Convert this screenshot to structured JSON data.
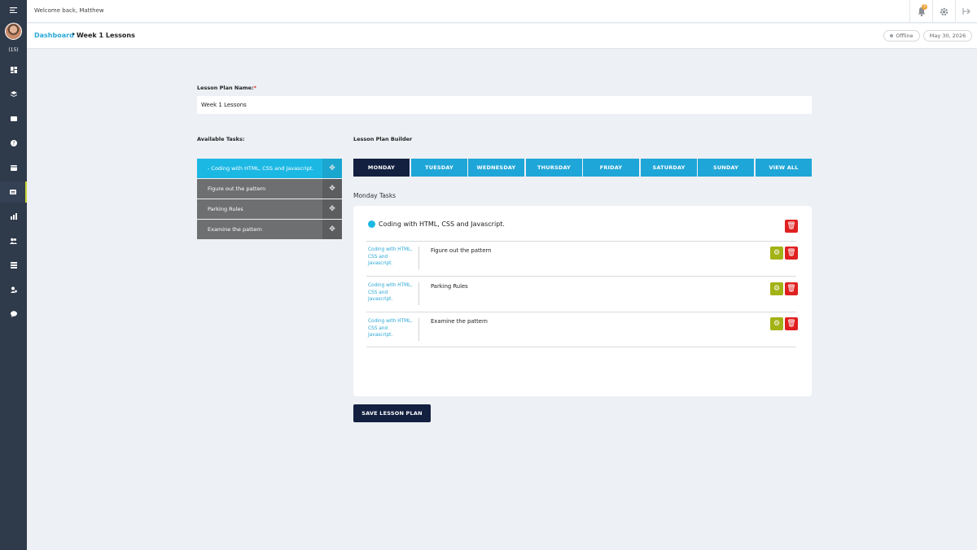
{
  "topbar": {
    "welcome": "Welcome back, Matthew",
    "notification_count": "3"
  },
  "sidebar": {
    "level": "(15)"
  },
  "breadcrumb": {
    "root": "Dashboard",
    "separator": "•",
    "current": "Week 1 Lessons"
  },
  "status": {
    "connection": "Offline",
    "date": "May 30, 2026"
  },
  "form": {
    "name_label": "Lesson Plan Name:",
    "required_mark": "*",
    "name_value": "Week 1 Lessons",
    "available_label": "Available Tasks:",
    "builder_label": "Lesson Plan Builder"
  },
  "available_tasks": [
    {
      "label": "- Coding with HTML, CSS and Javascript."
    },
    {
      "label": "Figure out the pattern"
    },
    {
      "label": "Parking Rules"
    },
    {
      "label": "Examine the pattern"
    }
  ],
  "days": [
    "MONDAY",
    "TUESDAY",
    "WEDNESDAY",
    "THURSDAY",
    "FRIDAY",
    "SATURDAY",
    "SUNDAY",
    "VIEW ALL"
  ],
  "selected_day": "MONDAY",
  "day_tasks_heading": "Monday Tasks",
  "main_task": "Coding with HTML, CSS and Javascript.",
  "subtasks": [
    {
      "parent": "Coding with HTML, CSS and Javascript.",
      "name": "Figure out the pattern"
    },
    {
      "parent": "Coding with HTML, CSS and Javascript.",
      "name": "Parking Rules"
    },
    {
      "parent": "Coding with HTML, CSS and Javascript.",
      "name": "Examine the pattern"
    }
  ],
  "save_label": "SAVE LESSON PLAN",
  "colors": {
    "accent": "#1ea6d8",
    "dark": "#132040",
    "sidebar": "#2f3a4b",
    "delete": "#e02020",
    "settings": "#a3b215"
  }
}
